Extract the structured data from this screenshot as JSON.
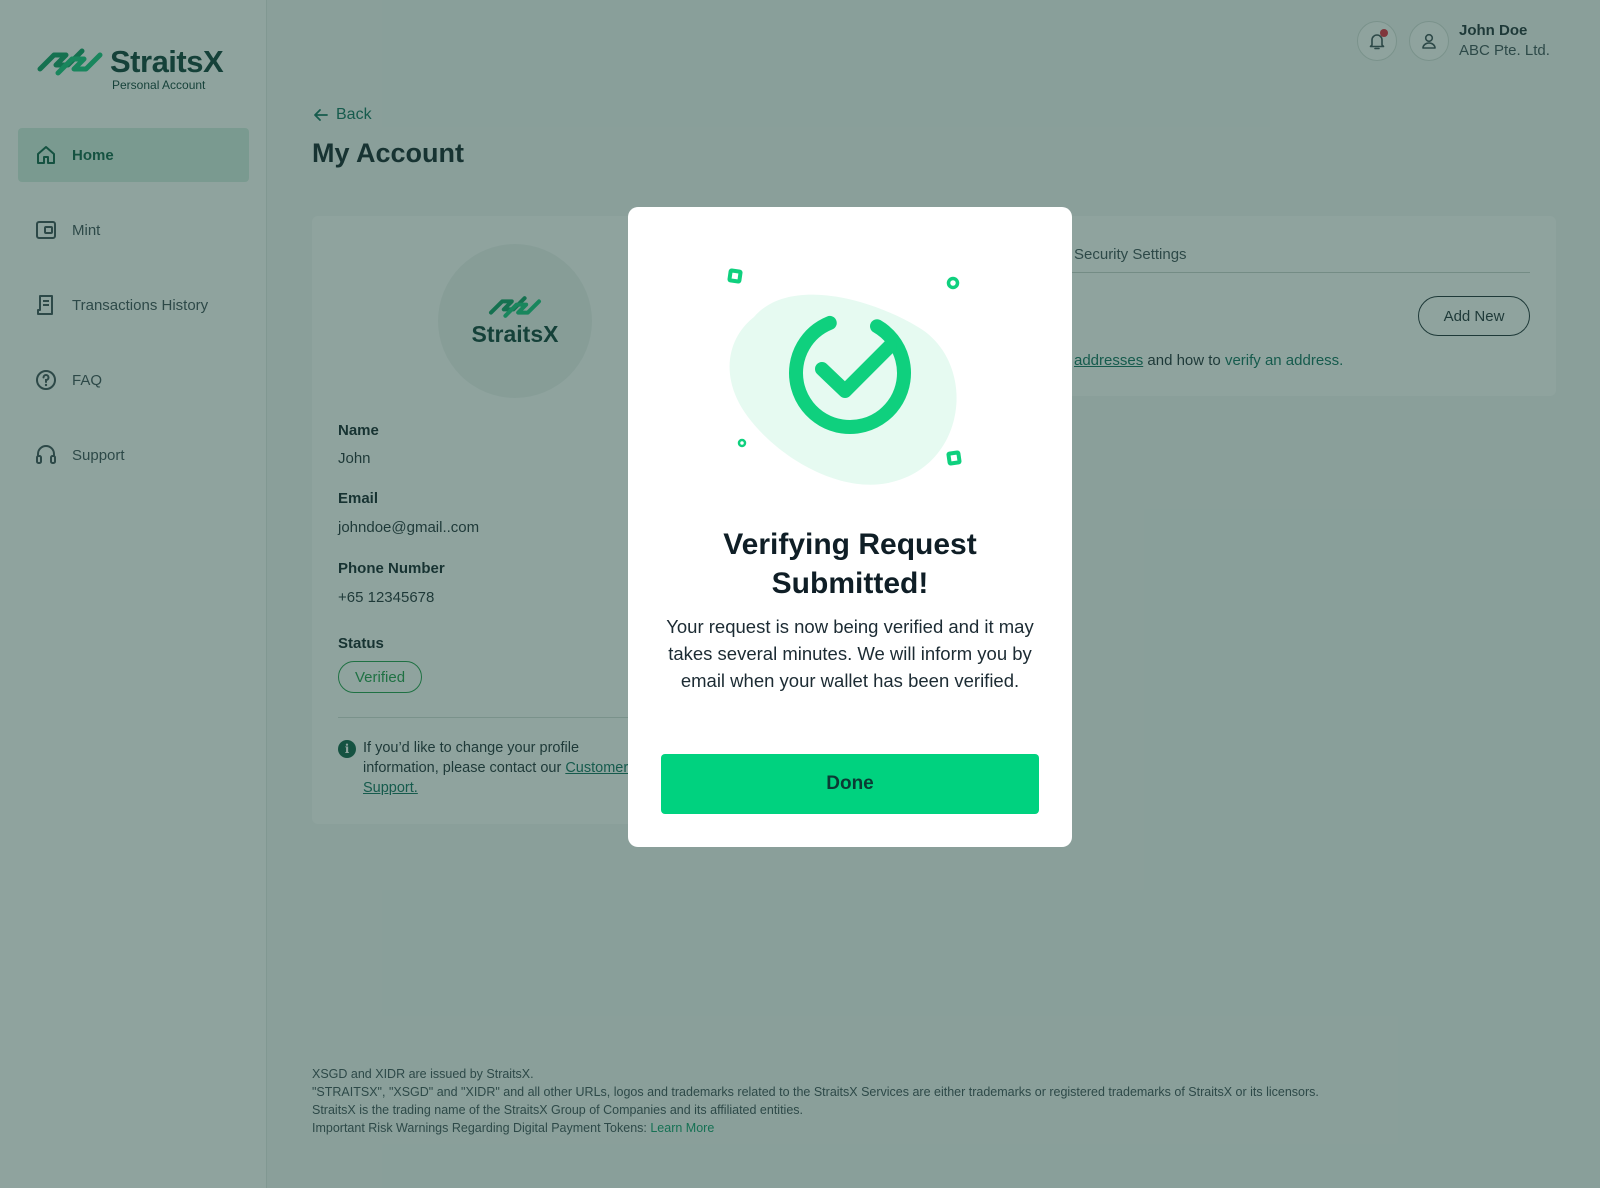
{
  "brand": {
    "name": "StraitsX",
    "subtitle": "Personal Account",
    "color": "#0b3a34",
    "accent": "#00d27f"
  },
  "sidebar": {
    "items": [
      {
        "label": "Home",
        "icon": "home-icon",
        "active": true
      },
      {
        "label": "Mint",
        "icon": "wallet-icon",
        "active": false
      },
      {
        "label": "Transactions History",
        "icon": "receipt-icon",
        "active": false
      },
      {
        "label": "FAQ",
        "icon": "question-circle-icon",
        "active": false
      },
      {
        "label": "Support",
        "icon": "headset-icon",
        "active": false
      }
    ]
  },
  "header": {
    "user_name": "John Doe",
    "user_org": "ABC Pte. Ltd.",
    "has_notification": true
  },
  "main": {
    "back_label": "Back",
    "title": "My Account",
    "profile": {
      "avatar_text": "StraitsX",
      "name_label": "Name",
      "name_value": "John",
      "email_label": "Email",
      "email_value": "johndoe@gmail..com",
      "phone_label": "Phone Number",
      "phone_value": "+65 12345678",
      "status_label": "Status",
      "status_value": "Verified",
      "info_text_1": "If you’d like to change your profile information, please contact our ",
      "info_link": "Customer Support."
    },
    "security": {
      "tab_label": "Security Settings",
      "add_new_label": "Add New",
      "addresses_link": "addresses",
      "addresses_mid": " and how to ",
      "verify_link": "verify an address."
    }
  },
  "footer": {
    "line1": "XSGD and XIDR are issued by StraitsX.",
    "line2": "\"STRAITSX\", \"XSGD\" and \"XIDR\" and all other URLs, logos and trademarks related to the StraitsX Services are either trademarks or registered trademarks of StraitsX or its licensors.",
    "line3": "StraitsX is the trading name of the StraitsX Group of Companies and its affiliated entities.",
    "line4": "Important Risk Warnings Regarding Digital Payment Tokens: ",
    "learn_more": "Learn More"
  },
  "modal": {
    "title": "Verifying Request Submitted!",
    "body": "Your request is now being verified and it may takes several minutes. We will inform you by email when your wallet has been verified.",
    "done_label": "Done",
    "icon": "check-circle-icon"
  }
}
